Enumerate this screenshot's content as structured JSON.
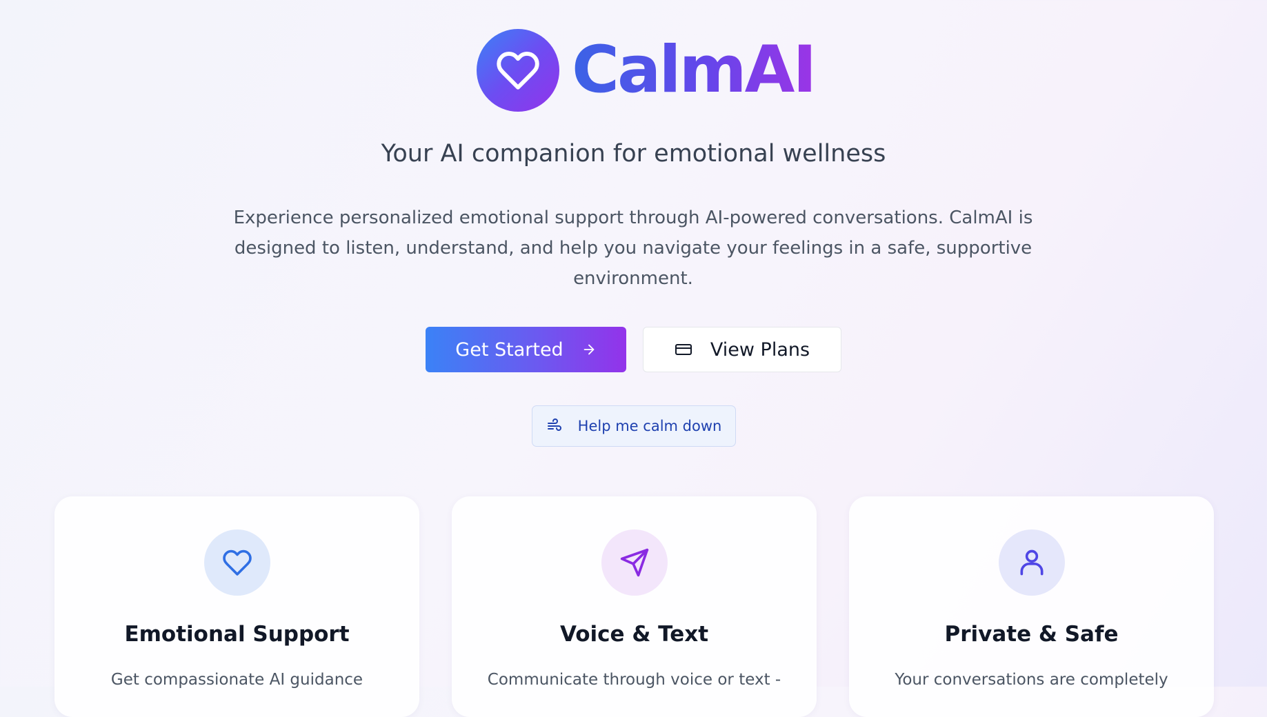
{
  "brand": {
    "name": "CalmAI",
    "icon": "heart-icon"
  },
  "hero": {
    "tagline": "Your AI companion for emotional wellness",
    "description": "Experience personalized emotional support through AI-powered conversations. CalmAI is designed to listen, understand, and help you navigate your feelings in a safe, supportive environment."
  },
  "actions": {
    "get_started": {
      "label": "Get Started",
      "icon": "arrow-right-icon"
    },
    "view_plans": {
      "label": "View Plans",
      "icon": "credit-card-icon"
    },
    "calm_down": {
      "label": "Help me calm down",
      "icon": "wind-icon"
    }
  },
  "features": [
    {
      "title": "Emotional Support",
      "description": "Get compassionate AI guidance",
      "icon": "heart-icon",
      "icon_color": "#2f6fe4",
      "icon_bg": "#dfe9fb"
    },
    {
      "title": "Voice & Text",
      "description": "Communicate through voice or text -",
      "icon": "send-icon",
      "icon_color": "#8a2be2",
      "icon_bg": "#f3e6fb"
    },
    {
      "title": "Private & Safe",
      "description": "Your conversations are completely",
      "icon": "user-icon",
      "icon_color": "#4f46e5",
      "icon_bg": "#e5e7fb"
    }
  ],
  "colors": {
    "accent_blue": "#3b82f6",
    "accent_purple": "#9333ea",
    "calm_button_text": "#1e40af"
  }
}
